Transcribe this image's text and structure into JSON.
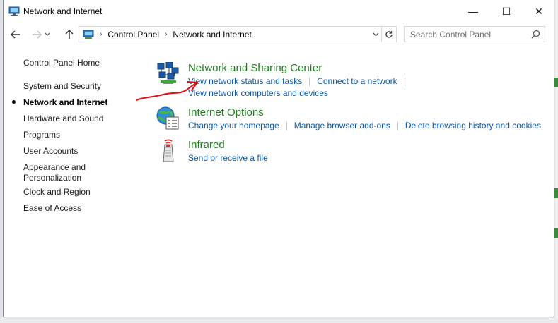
{
  "window": {
    "title": "Network and Internet",
    "icon": "network-internet-icon"
  },
  "titlebar_buttons": {
    "minimize": "—",
    "maximize": "☐",
    "close": "✕"
  },
  "address": {
    "crumbs": [
      "Control Panel",
      "Network and Internet"
    ]
  },
  "search": {
    "placeholder": "Search Control Panel"
  },
  "sidebar": {
    "items": [
      {
        "label": "Control Panel Home"
      },
      {
        "label": "System and Security"
      },
      {
        "label": "Network and Internet",
        "active": true
      },
      {
        "label": "Hardware and Sound"
      },
      {
        "label": "Programs"
      },
      {
        "label": "User Accounts"
      },
      {
        "label": "Appearance and Personalization"
      },
      {
        "label": "Clock and Region"
      },
      {
        "label": "Ease of Access"
      }
    ]
  },
  "categories": [
    {
      "title": "Network and Sharing Center",
      "icon": "network-sharing-center-icon",
      "links": [
        "View network status and tasks",
        "Connect to a network",
        "View network computers and devices"
      ]
    },
    {
      "title": "Internet Options",
      "icon": "internet-options-icon",
      "links": [
        "Change your homepage",
        "Manage browser add-ons",
        "Delete browsing history and cookies"
      ]
    },
    {
      "title": "Infrared",
      "icon": "infrared-icon",
      "links": [
        "Send or receive a file"
      ]
    }
  ],
  "colors": {
    "category_title": "#1e7b1e",
    "link": "#0b55a8",
    "annotation": "#e01010"
  }
}
